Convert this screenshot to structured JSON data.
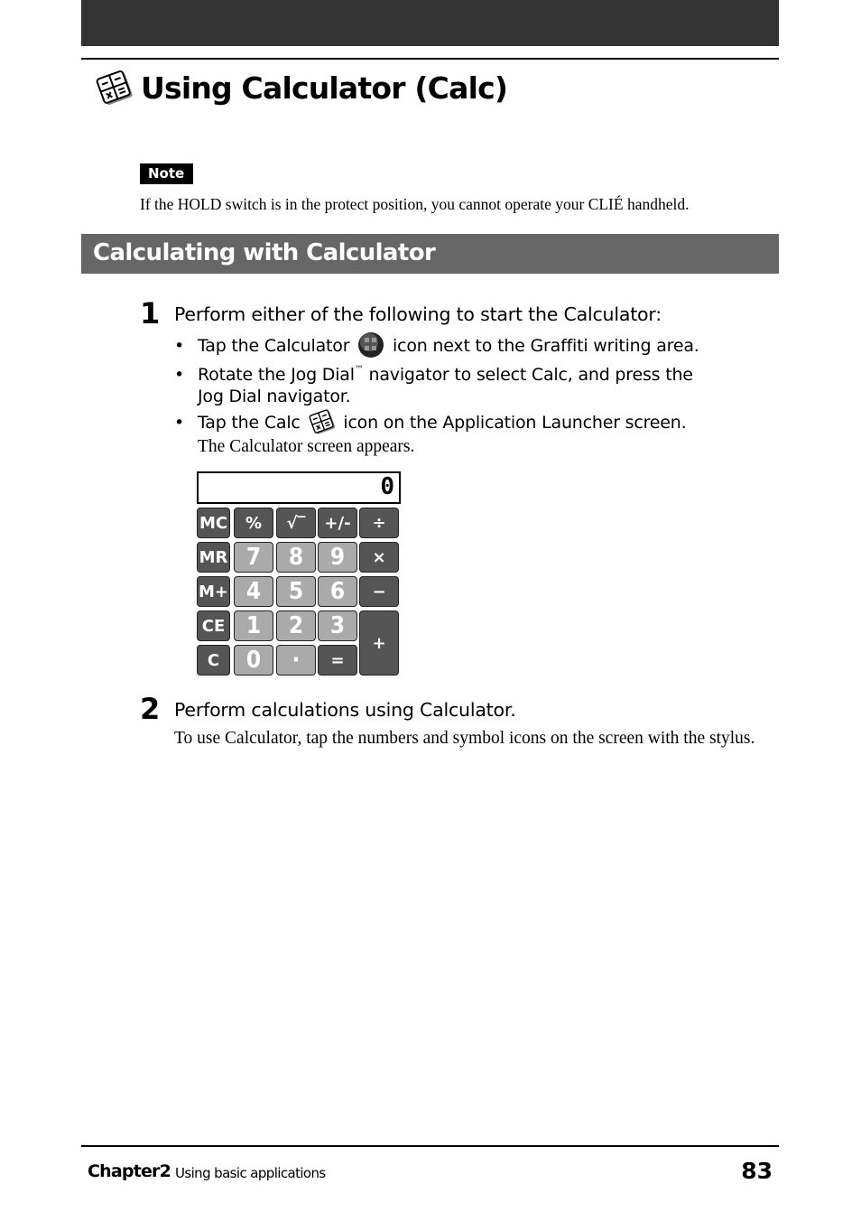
{
  "page": {
    "title": "Using Calculator (Calc)",
    "title_icon": "calc-app-icon"
  },
  "note": {
    "badge": "Note",
    "text": "If the HOLD switch is in the protect position, you cannot operate your CLIÉ handheld."
  },
  "section": {
    "title": "Calculating with Calculator"
  },
  "steps": [
    {
      "number": "1",
      "heading": "Perform either of the following to start the Calculator:",
      "bullets": [
        {
          "before": "Tap the Calculator",
          "icon": "calculator-button-icon",
          "after": "icon next to the Graffiti writing area."
        },
        {
          "before": "Rotate the Jog Dial",
          "tm": "™",
          "after": "navigator to select Calc, and press the",
          "continuation": "Jog Dial navigator."
        },
        {
          "before": "Tap the Calc",
          "icon": "calc-app-icon",
          "after": "icon on the Application Launcher screen."
        }
      ],
      "result": "The Calculator screen appears."
    },
    {
      "number": "2",
      "heading": "Perform calculations using Calculator.",
      "body": "To use Calculator, tap the numbers and symbol icons on the screen with the stylus."
    }
  ],
  "calculator": {
    "display_value": "0",
    "keys": [
      {
        "label": "MC",
        "style": "dark"
      },
      {
        "label": "%",
        "style": "dark"
      },
      {
        "label": "√‾",
        "style": "dark"
      },
      {
        "label": "+/-",
        "style": "dark"
      },
      {
        "label": "÷",
        "style": "dark"
      },
      {
        "label": "MR",
        "style": "dark"
      },
      {
        "label": "7",
        "style": "light"
      },
      {
        "label": "8",
        "style": "light"
      },
      {
        "label": "9",
        "style": "light"
      },
      {
        "label": "×",
        "style": "dark"
      },
      {
        "label": "M+",
        "style": "dark"
      },
      {
        "label": "4",
        "style": "light"
      },
      {
        "label": "5",
        "style": "light"
      },
      {
        "label": "6",
        "style": "light"
      },
      {
        "label": "−",
        "style": "dark"
      },
      {
        "label": "CE",
        "style": "dark"
      },
      {
        "label": "1",
        "style": "light"
      },
      {
        "label": "2",
        "style": "light"
      },
      {
        "label": "3",
        "style": "light"
      },
      {
        "label": "+",
        "style": "dark"
      },
      {
        "label": "C",
        "style": "dark"
      },
      {
        "label": "0",
        "style": "light"
      },
      {
        "label": "·",
        "style": "light"
      },
      {
        "label": "=",
        "style": "dark"
      }
    ]
  },
  "footer": {
    "chapter": "Chapter2",
    "subtitle": "Using basic applications",
    "page_number": "83"
  }
}
